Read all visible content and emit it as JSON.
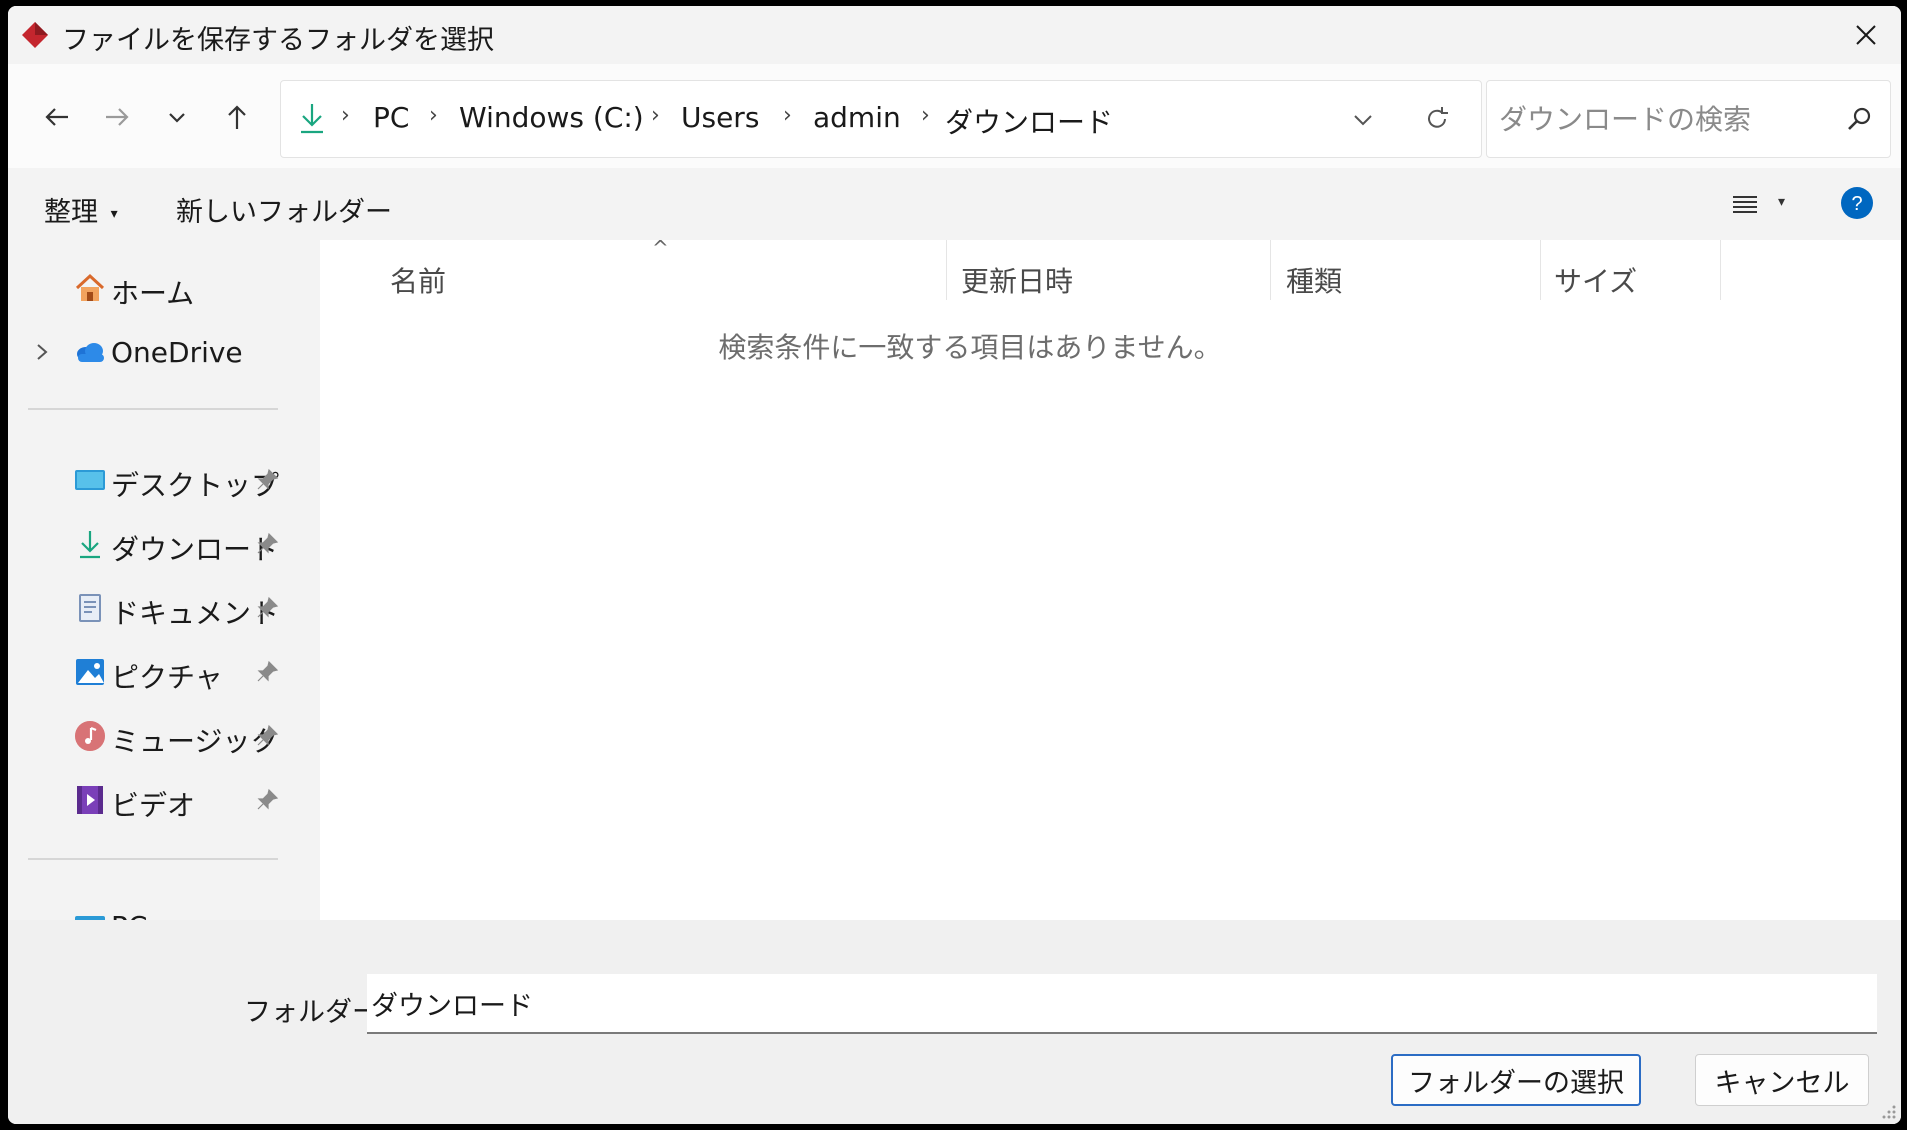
{
  "window": {
    "title": "ファイルを保存するフォルダを選択"
  },
  "address": {
    "crumbs": [
      "PC",
      "Windows (C:)",
      "Users",
      "admin",
      "ダウンロード"
    ]
  },
  "search": {
    "placeholder": "ダウンロードの検索"
  },
  "commandbar": {
    "organize": "整理",
    "new_folder": "新しいフォルダー"
  },
  "sidebar": {
    "items": [
      {
        "label": "ホーム",
        "icon": "home-icon"
      },
      {
        "label": "OneDrive",
        "icon": "onedrive-cloud-icon"
      },
      {
        "label": "デスクトップ",
        "icon": "desktop-icon",
        "pinned": true
      },
      {
        "label": "ダウンロード",
        "icon": "download-icon",
        "pinned": true
      },
      {
        "label": "ドキュメント",
        "icon": "document-icon",
        "pinned": true
      },
      {
        "label": "ピクチャ",
        "icon": "pictures-icon",
        "pinned": true
      },
      {
        "label": "ミュージック",
        "icon": "music-icon",
        "pinned": true
      },
      {
        "label": "ビデオ",
        "icon": "video-icon",
        "pinned": true
      }
    ],
    "partial_label": "PC"
  },
  "filelist": {
    "columns": [
      "名前",
      "更新日時",
      "種類",
      "サイズ"
    ],
    "empty_message": "検索条件に一致する項目はありません。"
  },
  "footer": {
    "folder_label": "フォルダー:",
    "folder_value": "ダウンロード",
    "select_button": "フォルダーの選択",
    "cancel_button": "キャンセル"
  },
  "colors": {
    "accent": "#0067c0",
    "app_icon": "#c4262e",
    "download": "#1aa680"
  }
}
